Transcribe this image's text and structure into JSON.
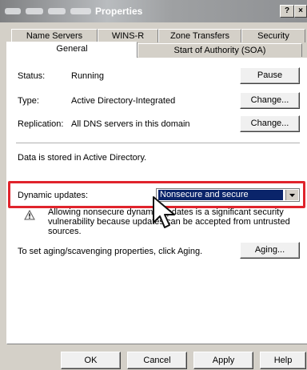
{
  "window": {
    "title": "Properties"
  },
  "title_buttons": {
    "help": "?",
    "close": "×"
  },
  "tabs": {
    "row1": [
      "Name Servers",
      "WINS-R",
      "Zone Transfers",
      "Security"
    ],
    "row2": [
      "General",
      "Start of Authority (SOA)"
    ]
  },
  "general": {
    "status_label": "Status:",
    "status_value": "Running",
    "pause_button": "Pause",
    "type_label": "Type:",
    "type_value": "Active Directory-Integrated",
    "change_button": "Change...",
    "replication_label": "Replication:",
    "replication_value": "All DNS servers in this domain",
    "change_button2": "Change...",
    "data_store_text": "Data is stored in Active Directory.",
    "dynamic_updates_label": "Dynamic updates:",
    "dynamic_updates_value": "Nonsecure and secure",
    "warning_line1": "Allowing nonsecure dynamic updates is a significant security",
    "warning_line2": "vulnerability because updates can be accepted from untrusted",
    "warning_line3": "sources.",
    "aging_text": "To set aging/scavenging properties, click Aging.",
    "aging_button": "Aging..."
  },
  "footer": {
    "ok": "OK",
    "cancel": "Cancel",
    "apply": "Apply",
    "help": "Help"
  },
  "colors": {
    "highlight_border": "#e0242c",
    "selection": "#0a246a",
    "dialog_bg": "#d4d0c8"
  }
}
